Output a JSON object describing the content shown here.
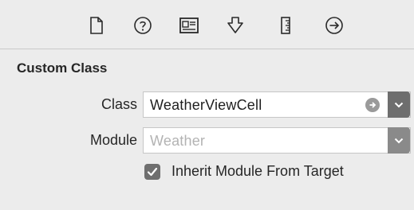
{
  "toolbar": {
    "icons": [
      "file-icon",
      "help-icon",
      "identity-icon",
      "attributes-icon",
      "size-icon",
      "connections-icon"
    ]
  },
  "custom_class": {
    "title": "Custom Class",
    "class_label": "Class",
    "class_value": "WeatherViewCell",
    "module_label": "Module",
    "module_placeholder": "Weather",
    "inherit_checked": true,
    "inherit_label": "Inherit Module From Target"
  },
  "colors": {
    "background": "#ececec",
    "field_bg": "#ffffff",
    "button_gray": "#6e6e6e"
  }
}
